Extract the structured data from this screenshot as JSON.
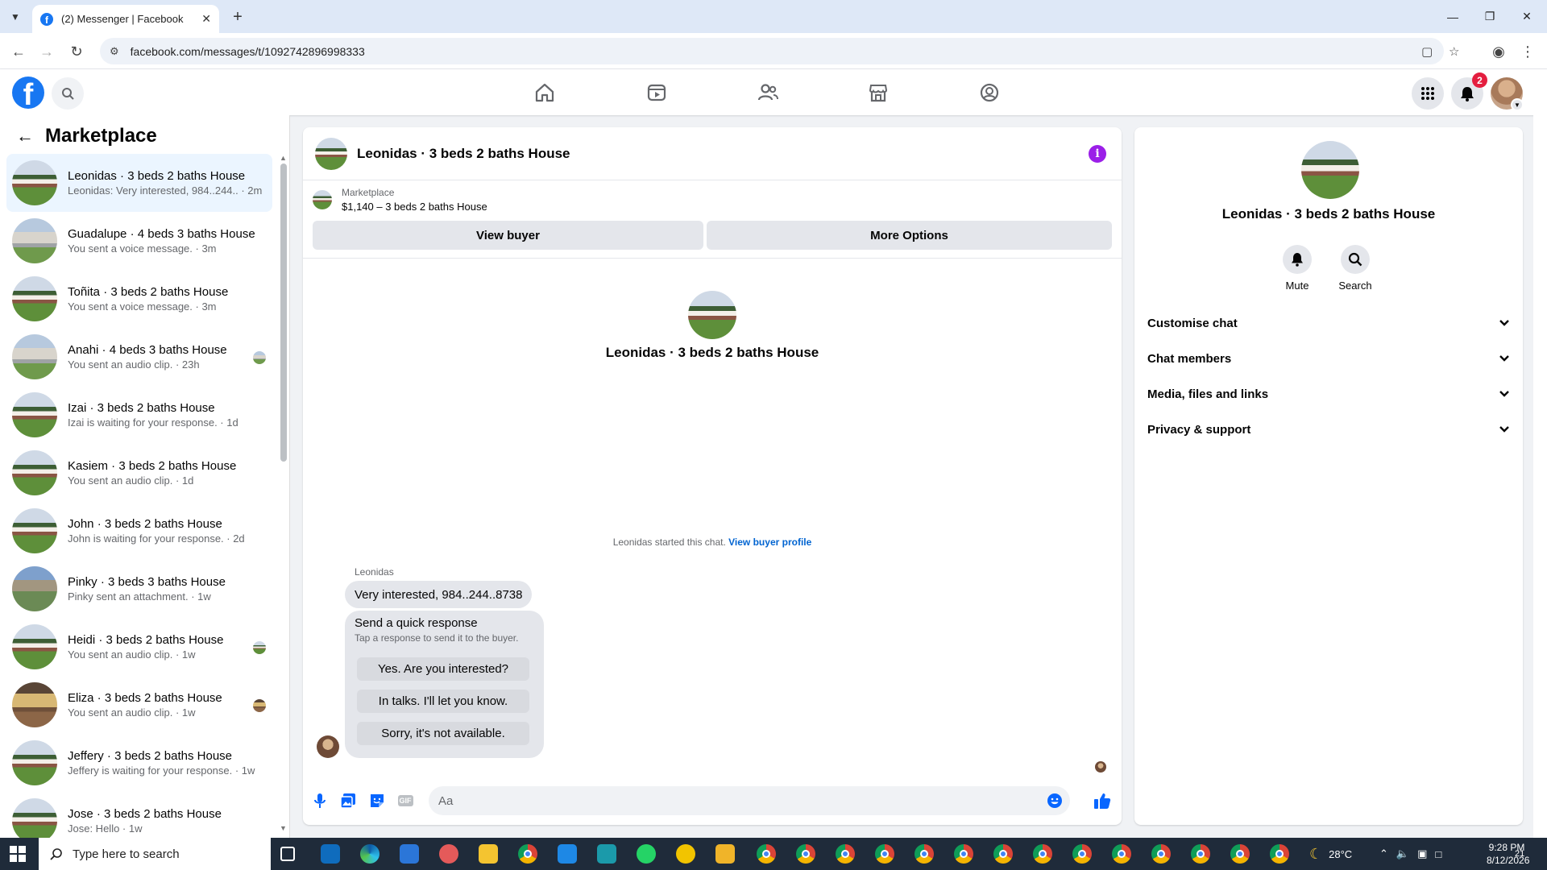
{
  "browser": {
    "tab_title": "(2) Messenger | Facebook",
    "url": "facebook.com/messages/t/1092742896998333"
  },
  "header": {
    "notification_count": "2"
  },
  "sidebar": {
    "heading": "Marketplace",
    "conversations": [
      {
        "name": "Leonidas · 3 beds 2 baths House",
        "preview": "Leonidas: Very interested, 984..244.. · 2m",
        "thumb": "house1",
        "active": true
      },
      {
        "name": "Guadalupe · 4 beds 3 baths House",
        "preview": "You sent a voice message. · 3m",
        "thumb": "house2"
      },
      {
        "name": "Toñita · 3 beds 2 baths House",
        "preview": "You sent a voice message. · 3m",
        "thumb": "house1"
      },
      {
        "name": "Anahi · 4 beds 3 baths House",
        "preview": "You sent an audio clip. · 23h",
        "thumb": "house2",
        "seen": true
      },
      {
        "name": "Izai · 3 beds 2 baths House",
        "preview": "Izai is waiting for your response. · 1d",
        "thumb": "house1"
      },
      {
        "name": "Kasiem · 3 beds 2 baths House",
        "preview": "You sent an audio clip. · 1d",
        "thumb": "house1"
      },
      {
        "name": "John · 3 beds 2 baths House",
        "preview": "John is waiting for your response. · 2d",
        "thumb": "house1"
      },
      {
        "name": "Pinky · 3 beds 3 baths House",
        "preview": "Pinky sent an attachment. · 1w",
        "thumb": "house3"
      },
      {
        "name": "Heidi · 3 beds 2 baths House",
        "preview": "You sent an audio clip. · 1w",
        "thumb": "house1",
        "seen": true
      },
      {
        "name": "Eliza · 3 beds 2 baths House",
        "preview": "You sent an audio clip. · 1w",
        "thumb": "house4",
        "seen": true
      },
      {
        "name": "Jeffery · 3 beds 2 baths House",
        "preview": "Jeffery is waiting for your response. · 1w",
        "thumb": "house1"
      },
      {
        "name": "Jose · 3 beds 2 baths House",
        "preview": "Jose: Hello · 1w",
        "thumb": "house1"
      }
    ]
  },
  "chat": {
    "title": "Leonidas · 3 beds 2 baths House",
    "marketplace_label": "Marketplace",
    "listing": "$1,140 – 3 beds 2 baths House",
    "view_buyer_label": "View buyer",
    "more_options_label": "More Options",
    "intro_name": "Leonidas · 3 beds 2 baths House",
    "started_text": "Leonidas started this chat.",
    "view_buyer_profile_label": "View buyer profile",
    "sender": "Leonidas",
    "message": "Very interested, 984..244..8738",
    "quick_response": {
      "title": "Send a quick response",
      "subtitle": "Tap a response to send it to the buyer.",
      "options": [
        "Yes. Are you interested?",
        "In talks. I'll let you know.",
        "Sorry, it's not available."
      ]
    },
    "composer_placeholder": "Aa",
    "gif_label": "GIF"
  },
  "details": {
    "name": "Leonidas · 3 beds 2 baths House",
    "mute_label": "Mute",
    "search_label": "Search",
    "sections": [
      "Customise chat",
      "Chat members",
      "Media, files and links",
      "Privacy & support"
    ]
  },
  "taskbar": {
    "search_placeholder": "Type here to search",
    "temperature": "28°C",
    "time": "9:28 PM",
    "date": "8/12/2026",
    "notification_count": "21"
  },
  "colors": {
    "fb_blue": "#1877f2",
    "active_row": "#ebf5ff",
    "info_purple": "#9b1fe8",
    "link_blue": "#0064d1"
  }
}
